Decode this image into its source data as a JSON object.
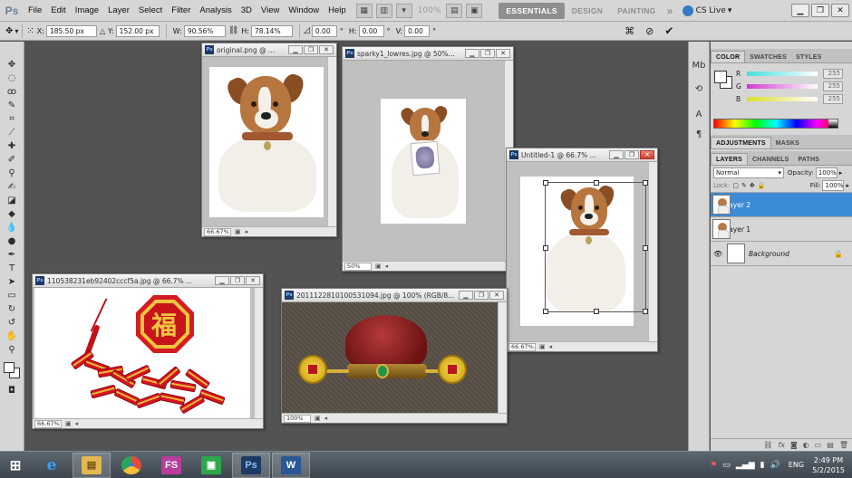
{
  "app": {
    "logo": "Ps",
    "menus": [
      "File",
      "Edit",
      "Image",
      "Layer",
      "Select",
      "Filter",
      "Analysis",
      "3D",
      "View",
      "Window",
      "Help"
    ],
    "zoom_display": "100%",
    "workspaces": [
      "ESSENTIALS",
      "DESIGN",
      "PAINTING"
    ],
    "active_workspace": "ESSENTIALS",
    "workspace_more": "»",
    "cs_live": "CS Live"
  },
  "options": {
    "x_label": "X:",
    "x_value": "185.50 px",
    "y_label": "Y:",
    "y_value": "152.00 px",
    "w_label": "W:",
    "w_value": "90.56%",
    "h_label": "H:",
    "h_value": "78.14%",
    "angle_value": "0.00",
    "angle_unit": "°",
    "hskew_label": "H:",
    "hskew_value": "0.00",
    "hskew_unit": "°",
    "vskew_label": "V:",
    "vskew_value": "0.00",
    "vskew_unit": "°"
  },
  "documents": {
    "original": {
      "title": "original.png @ ...",
      "zoom": "66.67%"
    },
    "sparky": {
      "title": "sparky1_lowres.jpg @ 50%...",
      "zoom": "50%"
    },
    "untitled": {
      "title": "Untitled-1 @ 66.7% ...",
      "zoom": "66.67%"
    },
    "firecracker": {
      "title": "110538231eb92402cccf5a.jpg @ 66.7% ...",
      "zoom": "66.67%",
      "char": "福"
    },
    "hat": {
      "title": "20111228101005310​94.jpg @ 100% (RGB/8...",
      "zoom": "100%"
    }
  },
  "color_panel": {
    "tabs": [
      "COLOR",
      "SWATCHES",
      "STYLES"
    ],
    "active_tab": "COLOR",
    "channels": [
      {
        "label": "R",
        "value": "255",
        "color": "#ff4a4a"
      },
      {
        "label": "G",
        "value": "255",
        "color": "#d03ad0"
      },
      {
        "label": "B",
        "value": "255",
        "color": "#dada2a"
      }
    ]
  },
  "adjust_panel": {
    "tabs": [
      "ADJUSTMENTS",
      "MASKS"
    ],
    "active_tab": "ADJUSTMENTS"
  },
  "layers_panel": {
    "tabs": [
      "LAYERS",
      "CHANNELS",
      "PATHS"
    ],
    "active_tab": "LAYERS",
    "blend_mode": "Normal",
    "opacity_label": "Opacity:",
    "opacity": "100%",
    "lock_label": "Lock:",
    "fill_label": "Fill:",
    "fill": "100%",
    "layers": [
      {
        "name": "Layer 2",
        "selected": true,
        "thumb": "dog"
      },
      {
        "name": "Layer 1",
        "selected": false,
        "thumb": "dog"
      },
      {
        "name": "Background",
        "selected": false,
        "thumb": "white",
        "locked": true
      }
    ]
  },
  "taskbar": {
    "apps": [
      {
        "name": "start",
        "glyph": "⊞",
        "color": "#4aa3ff"
      },
      {
        "name": "internet-explorer",
        "glyph": "e",
        "color": "#2d8ee6"
      },
      {
        "name": "file-explorer",
        "glyph": "▤",
        "color": "#e2b850"
      },
      {
        "name": "chrome",
        "glyph": "●",
        "color": "#e34c3b"
      },
      {
        "name": "fs-app",
        "glyph": "FS",
        "color": "#b83d9c"
      },
      {
        "name": "store",
        "glyph": "▣",
        "color": "#2ca84b"
      },
      {
        "name": "photoshop",
        "glyph": "Ps",
        "color": "#1d3a64"
      },
      {
        "name": "word",
        "glyph": "W",
        "color": "#2b5797"
      }
    ],
    "language": "ENG",
    "time": "2:49 PM",
    "date": "5/2/2015"
  }
}
